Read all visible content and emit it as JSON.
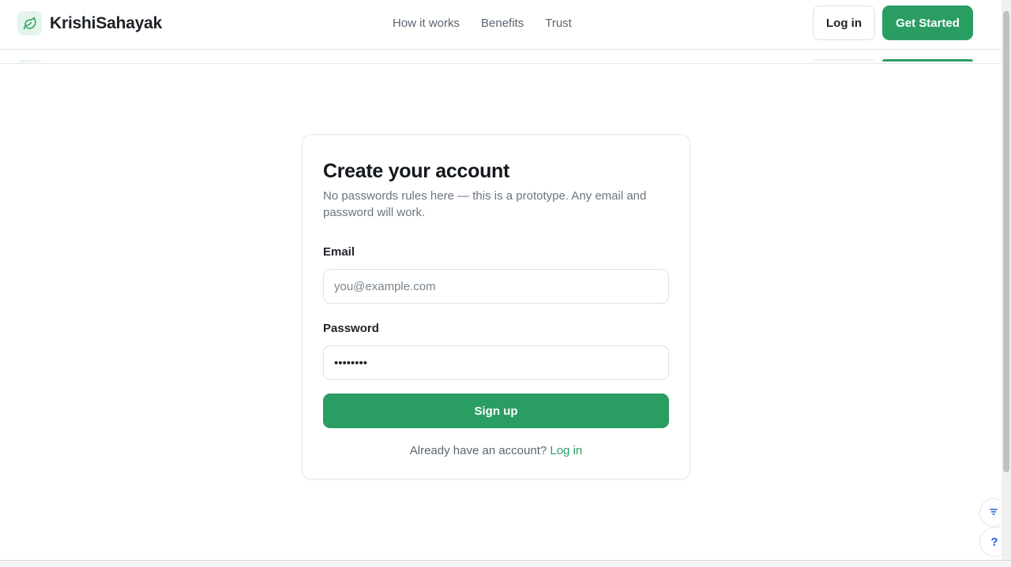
{
  "header": {
    "brand_name": "KrishiSahayak",
    "nav": [
      "How it works",
      "Benefits",
      "Trust"
    ],
    "login_label": "Log in",
    "get_started_label": "Get Started"
  },
  "signup": {
    "title": "Create your account",
    "subtitle": "No passwords rules here — this is a prototype. Any email and password will work.",
    "email_label": "Email",
    "email_placeholder": "you@example.com",
    "password_label": "Password",
    "password_value": "••••••••",
    "submit_label": "Sign up",
    "footer_text": "Already have an account?",
    "footer_link": "Log in"
  },
  "floating": {
    "filter_icon": "filter-icon",
    "help_label": "?"
  },
  "colors": {
    "accent": "#2a9d63",
    "accent_light": "#e4f4ea",
    "text_muted": "#6b7580"
  }
}
